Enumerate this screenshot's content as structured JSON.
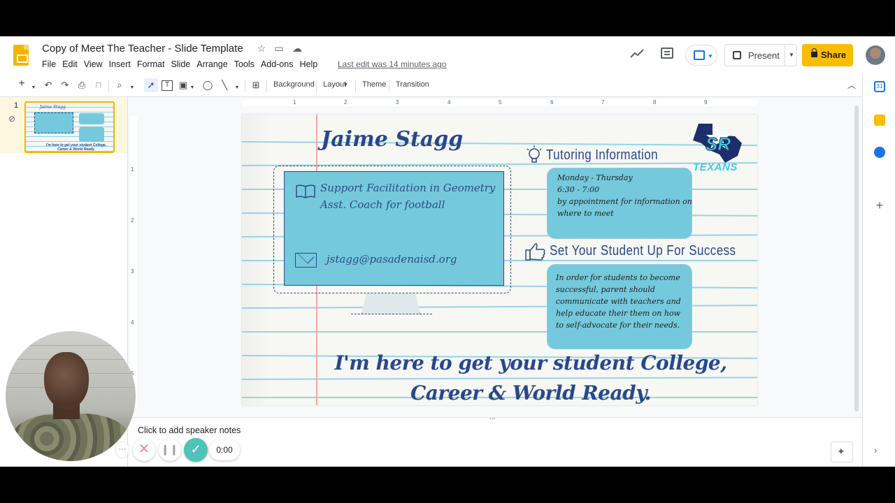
{
  "doc": {
    "title": "Copy of Meet The Teacher - Slide Template",
    "last_edit": "Last edit was 14 minutes ago"
  },
  "menu": [
    "File",
    "Edit",
    "View",
    "Insert",
    "Format",
    "Slide",
    "Arrange",
    "Tools",
    "Add-ons",
    "Help"
  ],
  "header": {
    "present_label": "Present",
    "share_label": "Share"
  },
  "toolbar": {
    "background": "Background",
    "layout": "Layout",
    "theme": "Theme",
    "transition": "Transition"
  },
  "filmstrip": {
    "slide_number": "1",
    "thumb_title": "Jaime Stagg",
    "thumb_motto": "I'm here to get your student College, Career & World Ready."
  },
  "rulers": {
    "horizontal_ticks": [
      "1",
      "2",
      "3",
      "4",
      "5",
      "6",
      "7",
      "8",
      "9"
    ],
    "vertical_ticks": [
      "1",
      "2",
      "3",
      "4",
      "5"
    ]
  },
  "slide": {
    "teacher_name": "Jaime Stagg",
    "info_line1": "Support Facilitation in Geometry",
    "info_line2": "Asst. Coach for football",
    "email": "jstagg@pasadenaisd.org",
    "tutoring_heading": "Tutoring Information",
    "tutoring_lines": [
      "Monday - Thursday",
      "6:30 - 7:00",
      "by appointment for information on",
      "where to meet"
    ],
    "success_heading": "Set Your Student Up For Success",
    "success_text": "In order for students to become successful, parent should communicate with teachers and help educate their them on how to self-advocate for their needs.",
    "motto": "I'm here to get your student College, Career & World Ready.",
    "logo_letters": "SR",
    "logo_text": "TEXANS"
  },
  "notes": {
    "placeholder": "Click to add speaker notes"
  },
  "recording": {
    "more": "···",
    "cancel": "✕",
    "pause": "❙❙",
    "done": "✓",
    "timer": "0:00"
  },
  "colors": {
    "brand_yellow": "#fbbc04",
    "slide_blue": "#28488c",
    "box_teal": "#75c9dc",
    "ruled_line": "#88cde3",
    "margin_red": "#f3a7a2",
    "record_teal": "#4fc3b8"
  },
  "icons": [
    "slides-logo-icon",
    "star-icon",
    "move-to-folder-icon",
    "cloud-saved-icon",
    "trend-icon",
    "comment-icon",
    "meet-present-icon",
    "present-icon",
    "lock-icon",
    "avatar",
    "new-slide-icon",
    "undo-icon",
    "redo-icon",
    "print-icon",
    "paint-format-icon",
    "zoom-icon",
    "select-icon",
    "text-box-icon",
    "image-icon",
    "shape-icon",
    "line-icon",
    "comment-add-icon",
    "collapse-chevron-icon",
    "book-icon",
    "mail-icon",
    "lightbulb-icon",
    "thumbs-up-icon",
    "calendar-icon",
    "keep-icon",
    "tasks-icon",
    "add-icon",
    "explore-icon"
  ]
}
